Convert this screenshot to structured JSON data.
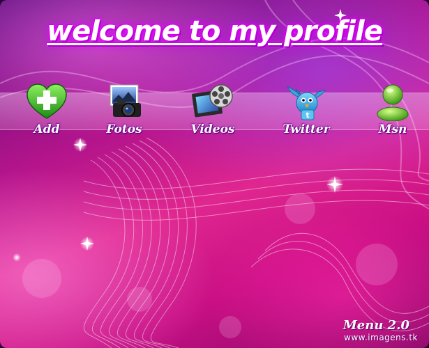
{
  "header": {
    "title": "welcome to my profile"
  },
  "menu": {
    "items": [
      {
        "label": "Add",
        "icon": "add-plus-heart-icon"
      },
      {
        "label": "Fotos",
        "icon": "camera-photo-icon"
      },
      {
        "label": "Videos",
        "icon": "film-reel-icon"
      },
      {
        "label": "Twitter",
        "icon": "twitter-bird-icon"
      },
      {
        "label": "Msn",
        "icon": "msn-messenger-icon"
      }
    ]
  },
  "footer": {
    "version": "Menu 2.0",
    "watermark": "www.imagens.tk"
  },
  "colors": {
    "background_primary": "#d91d8c",
    "background_dark": "#5a0d78",
    "title_glow": "#ff00ff",
    "text": "#ffffff"
  }
}
